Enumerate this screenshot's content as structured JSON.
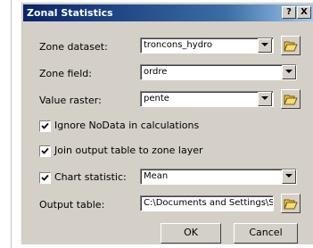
{
  "dialog": {
    "title": "Zonal Statistics",
    "help_button": "?",
    "close_button": "X"
  },
  "fields": {
    "zone_dataset": {
      "label": "Zone dataset:",
      "value": "troncons_hydro"
    },
    "zone_field": {
      "label": "Zone field:",
      "value": "ordre"
    },
    "value_raster": {
      "label": "Value raster:",
      "value": "pente"
    },
    "chart_statistic": {
      "label": "Chart statistic:",
      "value": "Mean"
    },
    "output_table": {
      "label": "Output table:",
      "value": "C:\\Documents and Settings\\S."
    }
  },
  "options": {
    "ignore_nodata": {
      "label": "Ignore NoData in calculations",
      "checked": true
    },
    "join_output": {
      "label": "Join output table to zone layer",
      "checked": true
    }
  },
  "buttons": {
    "ok": "OK",
    "cancel": "Cancel"
  },
  "icons": {
    "folder": "open-folder-icon",
    "dropdown": "chevron-down-icon",
    "check": "check-icon"
  }
}
